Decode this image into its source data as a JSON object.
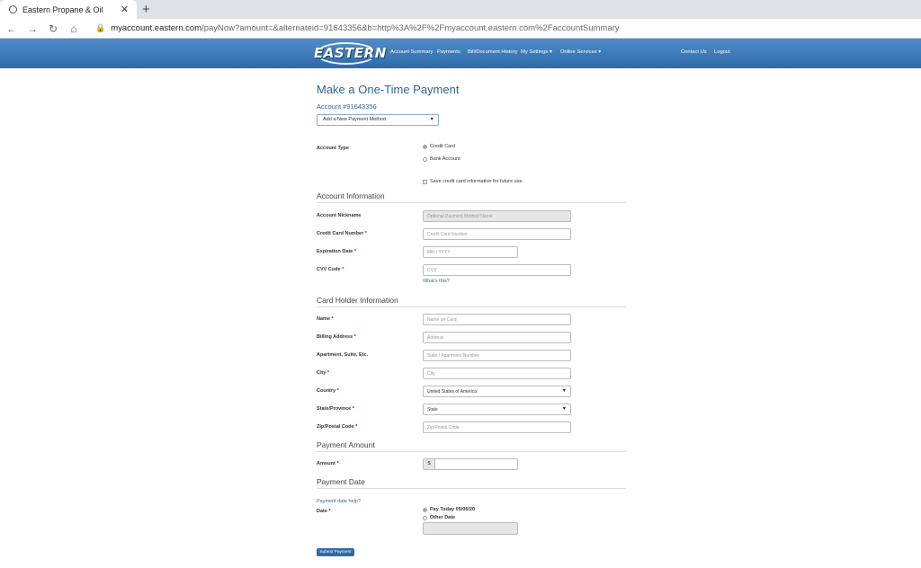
{
  "browser": {
    "tab_title": "Eastern Propane & Oil",
    "close_glyph": "✕",
    "new_tab_glyph": "+",
    "url_host": "myaccount.eastern.com",
    "url_path": "/payNow?amount=&alternateid=91643356&b=http%3A%2F%2Fmyaccount.eastern.com%2FaccountSummary"
  },
  "header": {
    "logo_text": "EASTERN",
    "nav": {
      "account_summary": "Account Summary",
      "payments": "Payments",
      "bill_history": "Bill/Document History",
      "my_settings": "My Settings ▾",
      "online_services": "Online Services ▾",
      "contact_us": "Contact Us",
      "logout": "Logout"
    }
  },
  "form": {
    "title": "Make a One-Time Payment",
    "account": "Account #91643356",
    "payment_method": "Add a New Payment Method",
    "account_type_label": "Account Type",
    "credit_card": "Credit Card",
    "bank_account": "Bank Account",
    "save_info": "Save credit card information for future use.",
    "account_info_title": "Account Information",
    "nickname_label": "Account Nickname",
    "nickname_placeholder": "Optional Payment Method Name",
    "cc_number_label": "Credit Card Number",
    "cc_number_placeholder": "Credit Card Number",
    "expiration_label": "Expiration Date",
    "expiration_placeholder": "MM / YYYY",
    "cvv_label": "CVV Code",
    "cvv_placeholder": "CVV",
    "whats_this": "What's this?",
    "holder_title": "Card Holder Information",
    "name_label": "Name",
    "name_placeholder": "Name on Card",
    "billing_label": "Billing Address",
    "billing_placeholder": "Address",
    "apt_label": "Apartment, Suite, Etc.",
    "apt_placeholder": "Suite / Apartment Number",
    "city_label": "City",
    "city_placeholder": "City",
    "country_label": "Country",
    "country_value": "United States of America",
    "state_label": "State/Province",
    "state_value": "State",
    "zip_label": "Zip/Postal Code",
    "zip_placeholder": "Zip/Postal Code",
    "amount_title": "Payment Amount",
    "amount_label": "Amount",
    "currency": "$",
    "date_title": "Payment Date",
    "date_help": "Payment date help?",
    "date_label": "Date",
    "pay_today": "Pay Today 05/06/20",
    "other_date": "Other Date",
    "submit": "Submit Payment",
    "required_mark": "*"
  },
  "colors": {
    "header_blue": "#2f6aa8",
    "link_blue": "#2d6699",
    "required_red": "#cc0000"
  }
}
